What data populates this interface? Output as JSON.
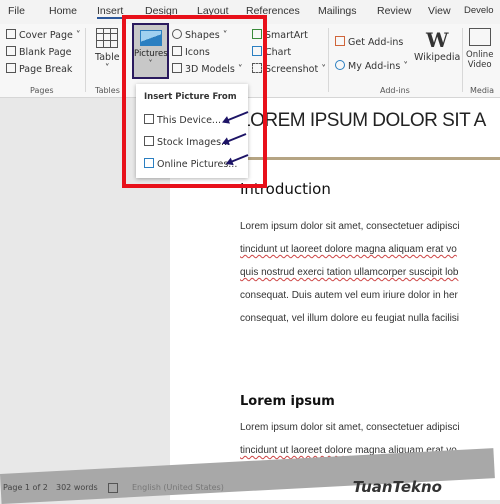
{
  "tabs": [
    "File",
    "Home",
    "Insert",
    "Design",
    "Layout",
    "References",
    "Mailings",
    "Review",
    "View",
    "Develo"
  ],
  "ribbon": {
    "pages": {
      "items": [
        "Cover Page",
        "Blank Page",
        "Page Break"
      ],
      "label": "Pages"
    },
    "tables": {
      "item": "Table",
      "label": "Tables"
    },
    "illustrations": {
      "pictures": "Pictures",
      "shapes": "Shapes",
      "icons": "Icons",
      "models": "3D Models",
      "smartart": "SmartArt",
      "chart": "Chart",
      "screenshot": "Screenshot"
    },
    "addins": {
      "get": "Get Add-ins",
      "my": "My Add-ins",
      "wikipedia": "Wikipedia",
      "label": "Add-ins"
    },
    "media": {
      "online": "Online",
      "video": "Video",
      "label": "Media"
    }
  },
  "menu": {
    "header": "Insert Picture From",
    "items": [
      "This Device...",
      "Stock Images...",
      "Online Pictures..."
    ]
  },
  "document": {
    "title": "LOREM IPSUM DOLOR SIT A",
    "heading1": "Introduction",
    "para1": [
      "Lorem ipsum dolor sit amet, consectetuer adipisci",
      "tincidunt ut laoreet dolore magna aliquam erat vo",
      "quis nostrud exerci tation ullamcorper suscipit lob",
      "consequat. Duis autem vel eum iriure dolor in her",
      "consequat, vel illum dolore eu feugiat nulla facilisi"
    ],
    "heading2": "Lorem ipsum",
    "para2": [
      "Lorem ipsum dolor sit amet, consectetuer adipisci",
      "tincidunt ut laoreet dolore magna aliquam erat vo"
    ]
  },
  "status": {
    "page": "Page 1 of 2",
    "words": "302 words",
    "language": "English (United States)"
  },
  "watermark": "TuanTekno",
  "colors": {
    "highlight": "#e8101a",
    "arrow": "#1d1466",
    "accent": "#2b579a"
  }
}
